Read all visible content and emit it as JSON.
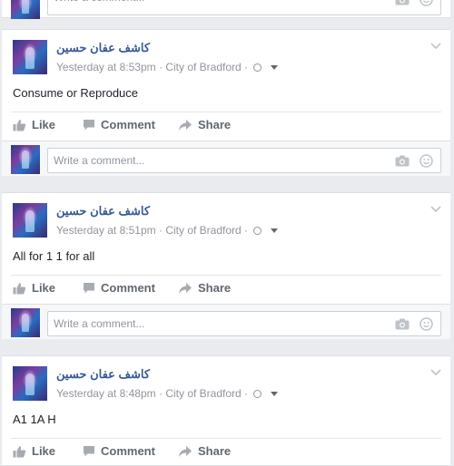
{
  "composer_placeholder": "Write a comment...",
  "actions": {
    "like": "Like",
    "comment": "Comment",
    "share": "Share"
  },
  "colors": {
    "name_link": "#365899",
    "meta_text": "#90949c",
    "action_text": "#606770",
    "background": "#e9ebee"
  },
  "posts": [
    {
      "author": "كاشف عفان حسين",
      "time": "Yesterday at 8:53pm",
      "location": "City of Bradford",
      "text": "Consume or Reproduce"
    },
    {
      "author": "كاشف عفان حسين",
      "time": "Yesterday at 8:51pm",
      "location": "City of Bradford",
      "text": "All for 1 1 for all"
    },
    {
      "author": "كاشف عفان حسين",
      "time": "Yesterday at 8:48pm",
      "location": "City of Bradford",
      "text": "A1 1A H"
    }
  ]
}
